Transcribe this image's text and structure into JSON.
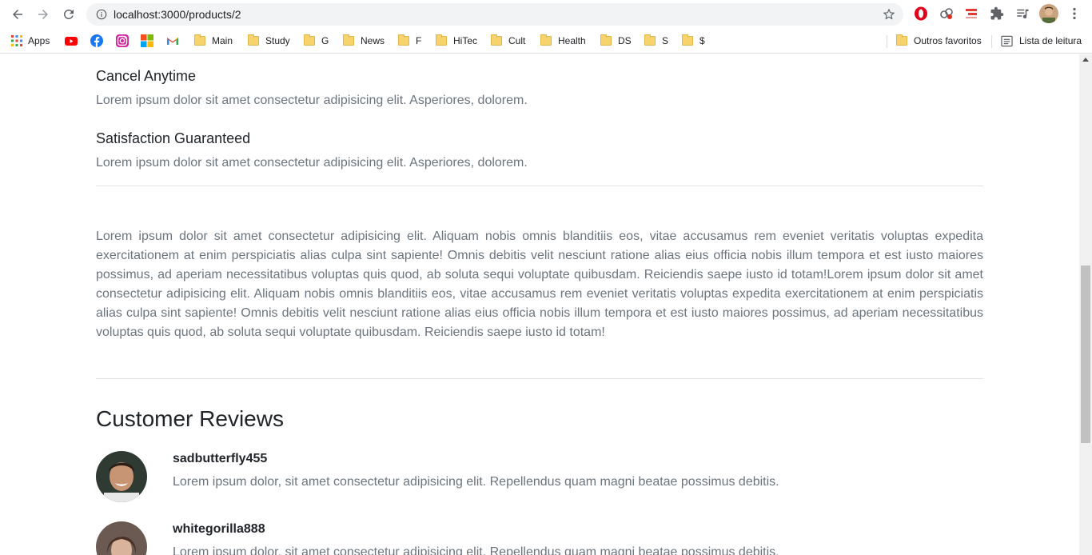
{
  "browser": {
    "url": "localhost:3000/products/2",
    "bookmarks": [
      {
        "label": "Apps",
        "icon": "apps-grid-icon"
      },
      {
        "label": "",
        "icon": "youtube-icon"
      },
      {
        "label": "",
        "icon": "facebook-icon"
      },
      {
        "label": "",
        "icon": "instagram-icon"
      },
      {
        "label": "",
        "icon": "microsoft-icon"
      },
      {
        "label": "",
        "icon": "gmail-icon"
      },
      {
        "label": "Main",
        "icon": "folder-icon"
      },
      {
        "label": "Study",
        "icon": "folder-icon"
      },
      {
        "label": "G",
        "icon": "folder-icon"
      },
      {
        "label": "News",
        "icon": "folder-icon"
      },
      {
        "label": "F",
        "icon": "folder-icon"
      },
      {
        "label": "HiTec",
        "icon": "folder-icon"
      },
      {
        "label": "Cult",
        "icon": "folder-icon"
      },
      {
        "label": "Health",
        "icon": "folder-icon"
      },
      {
        "label": "DS",
        "icon": "folder-icon"
      },
      {
        "label": "S",
        "icon": "folder-icon"
      },
      {
        "label": "$",
        "icon": "folder-icon"
      }
    ],
    "other_bookmarks": "Outros favoritos",
    "reading_list": "Lista de leitura"
  },
  "features": [
    {
      "title": "Cancel Anytime",
      "text": "Lorem ipsum dolor sit amet consectetur adipisicing elit. Asperiores, dolorem."
    },
    {
      "title": "Satisfaction Guaranteed",
      "text": "Lorem ipsum dolor sit amet consectetur adipisicing elit. Asperiores, dolorem."
    }
  ],
  "description": "Lorem ipsum dolor sit amet consectetur adipisicing elit. Aliquam nobis omnis blanditiis eos, vitae accusamus rem eveniet veritatis voluptas expedita exercitationem at enim perspiciatis alias culpa sint sapiente! Omnis debitis velit nesciunt ratione alias eius officia nobis illum tempora et est iusto maiores possimus, ad aperiam necessitatibus voluptas quis quod, ab soluta sequi voluptate quibusdam. Reiciendis saepe iusto id totam!Lorem ipsum dolor sit amet consectetur adipisicing elit. Aliquam nobis omnis blanditiis eos, vitae accusamus rem eveniet veritatis voluptas expedita exercitationem at enim perspiciatis alias culpa sint sapiente! Omnis debitis velit nesciunt ratione alias eius officia nobis illum tempora et est iusto maiores possimus, ad aperiam necessitatibus voluptas quis quod, ab soluta sequi voluptate quibusdam. Reiciendis saepe iusto id totam!",
  "reviews": {
    "title": "Customer Reviews",
    "items": [
      {
        "name": "sadbutterfly455",
        "text": "Lorem ipsum dolor, sit amet consectetur adipisicing elit. Repellendus quam magni beatae possimus debitis."
      },
      {
        "name": "whitegorilla888",
        "text": "Lorem ipsum dolor, sit amet consectetur adipisicing elit. Repellendus quam magni beatae possimus debitis."
      }
    ]
  }
}
